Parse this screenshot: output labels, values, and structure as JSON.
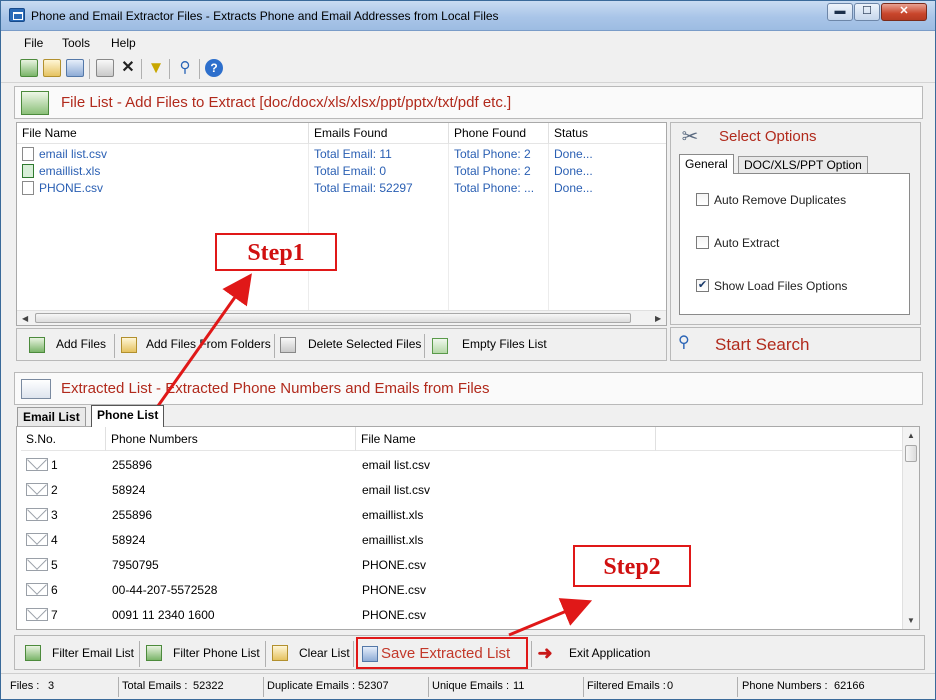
{
  "window": {
    "title": "Phone and Email Extractor Files  -  Extracts Phone and Email Addresses from Local Files",
    "minimize": "▬",
    "maximize": "☐",
    "close": "✕"
  },
  "menu": [
    "File",
    "Tools",
    "Help"
  ],
  "file_list": {
    "header": "File List - Add Files to Extract  [doc/docx/xls/xlsx/ppt/pptx/txt/pdf etc.]",
    "columns": [
      "File Name",
      "Emails Found",
      "Phone Found",
      "Status"
    ],
    "rows": [
      {
        "name": "email list.csv",
        "emails": "Total Email: 11",
        "phones": "Total Phone: 2",
        "status": "Done..."
      },
      {
        "name": "emaillist.xls",
        "emails": "Total Email: 0",
        "phones": "Total Phone: 2",
        "status": "Done..."
      },
      {
        "name": "PHONE.csv",
        "emails": "Total Email: 52297",
        "phones": "Total Phone: ...",
        "status": "Done..."
      }
    ],
    "buttons": [
      "Add Files",
      "Add Files From Folders",
      "Delete Selected Files",
      "Empty Files List"
    ]
  },
  "options": {
    "header": "Select Options",
    "tabs": [
      "General",
      "DOC/XLS/PPT Option"
    ],
    "checkboxes": [
      {
        "label": "Auto Remove Duplicates",
        "checked": false
      },
      {
        "label": "Auto Extract",
        "checked": false
      },
      {
        "label": "Show Load Files Options",
        "checked": true
      }
    ],
    "start_search": "Start Search"
  },
  "extracted": {
    "header": "Extracted List - Extracted Phone Numbers and Emails from Files",
    "tabs": [
      "Email List",
      "Phone List"
    ],
    "columns": [
      "S.No.",
      "Phone Numbers",
      "File Name"
    ],
    "rows": [
      {
        "sno": "1",
        "phone": "255896",
        "file": "email list.csv"
      },
      {
        "sno": "2",
        "phone": "58924",
        "file": "email list.csv"
      },
      {
        "sno": "3",
        "phone": "255896",
        "file": "emaillist.xls"
      },
      {
        "sno": "4",
        "phone": "58924",
        "file": "emaillist.xls"
      },
      {
        "sno": "5",
        "phone": "7950795",
        "file": "PHONE.csv"
      },
      {
        "sno": "6",
        "phone": "00-44-207-5572528",
        "file": "PHONE.csv"
      },
      {
        "sno": "7",
        "phone": "0091 11 2340 1600",
        "file": "PHONE.csv"
      }
    ],
    "buttons": [
      "Filter Email List",
      "Filter Phone List",
      "Clear List",
      "Save Extracted List",
      "Exit Application"
    ]
  },
  "annotations": {
    "step1": "Step1",
    "step2": "Step2",
    "color": "#e01818"
  },
  "status": [
    {
      "label": "Files :",
      "value": "3"
    },
    {
      "label": "Total Emails :",
      "value": "52322"
    },
    {
      "label": "Duplicate Emails :",
      "value": "52307"
    },
    {
      "label": "Unique Emails :",
      "value": "11"
    },
    {
      "label": "Filtered Emails :",
      "value": "0"
    },
    {
      "label": "Phone Numbers :",
      "value": "62166"
    }
  ],
  "colors": {
    "accent_red": "#b12a1c",
    "link_blue": "#2a5fb3",
    "title_bar": "#a9c5e8"
  }
}
